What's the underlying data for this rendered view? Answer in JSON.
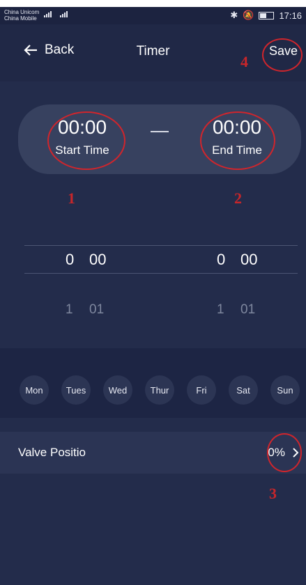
{
  "status_bar": {
    "carrier_1": "China Unicom",
    "carrier_2": "China Mobile",
    "signal_1": "4G",
    "signal_2": "4G",
    "time": "17:16"
  },
  "header": {
    "back_label": "Back",
    "title": "Timer",
    "save_label": "Save"
  },
  "time_range": {
    "start": {
      "time": "00:00",
      "label": "Start Time"
    },
    "end": {
      "time": "00:00",
      "label": "End Time"
    }
  },
  "picker": {
    "start": {
      "hour": "0",
      "minute": "00",
      "next_hour": "1",
      "next_minute": "01"
    },
    "end": {
      "hour": "0",
      "minute": "00",
      "next_hour": "1",
      "next_minute": "01"
    }
  },
  "days": [
    "Mon",
    "Tues",
    "Wed",
    "Thur",
    "Fri",
    "Sat",
    "Sun"
  ],
  "valve": {
    "label": "Valve Positio",
    "value": "0%"
  },
  "annotations": {
    "n1": "1",
    "n2": "2",
    "n3": "3",
    "n4": "4",
    "color": "#d0252c"
  },
  "colors": {
    "background": "#232c4b",
    "header": "#202846",
    "card": "#37415f",
    "day_band": "#1d2544",
    "day_button": "#2c3554",
    "valve_row": "#2b3454"
  }
}
